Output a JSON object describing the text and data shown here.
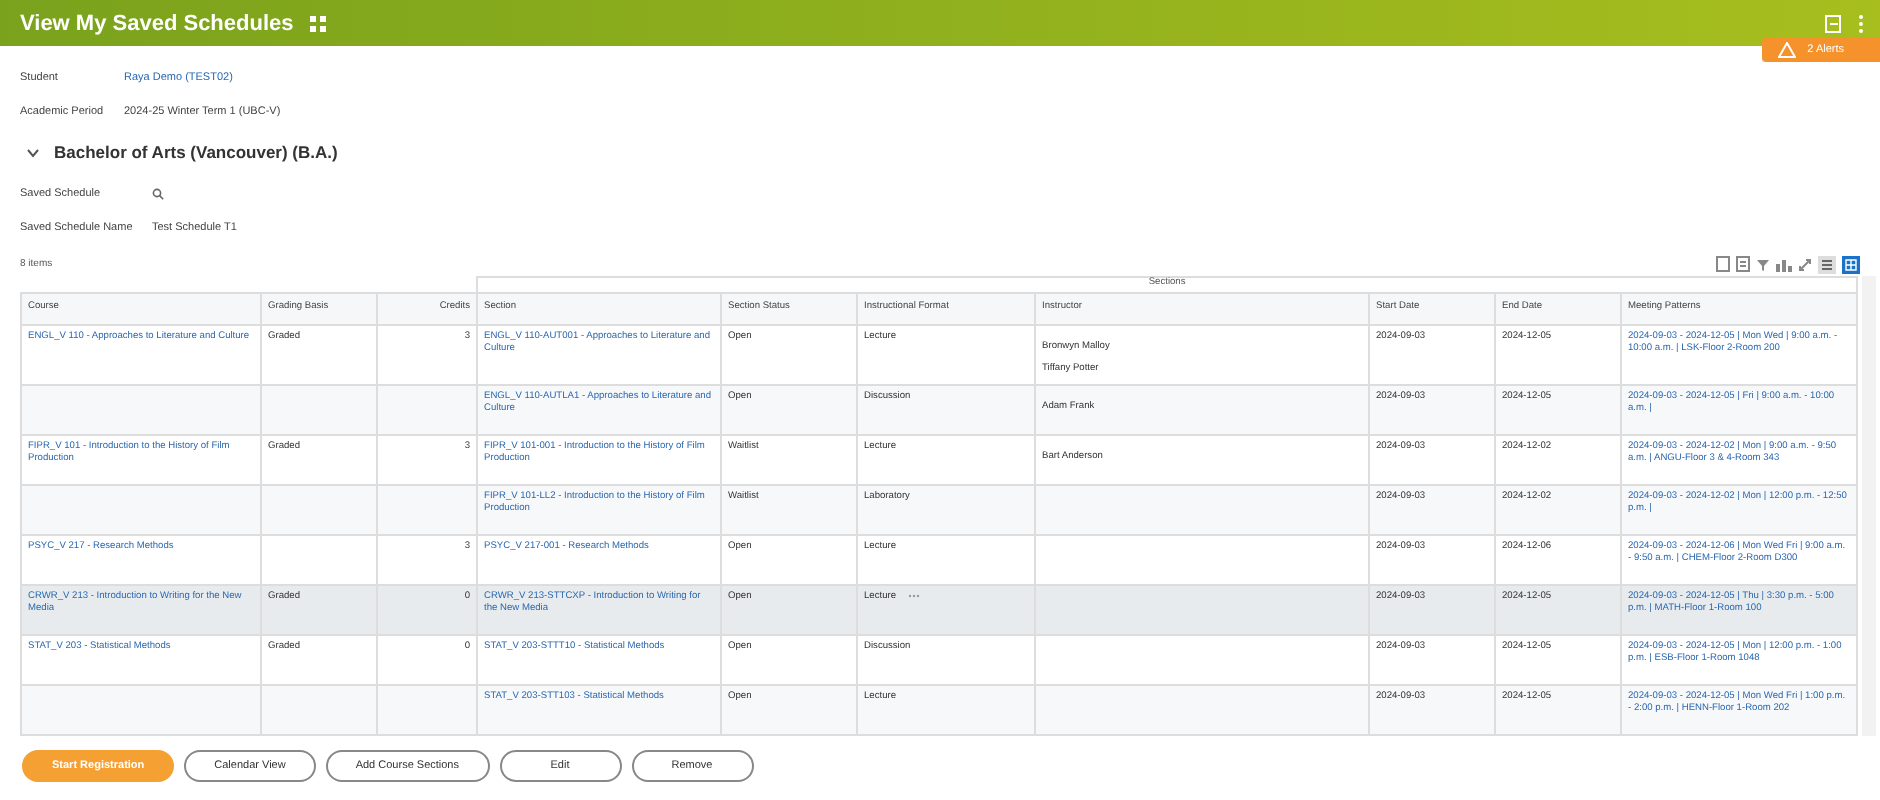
{
  "header": {
    "title": "View My Saved Schedules",
    "alert": "2 Alerts"
  },
  "student": {
    "label": "Student",
    "value": "Raya Demo (TEST02)"
  },
  "academic_period": {
    "label": "Academic Period",
    "value": "2024-25 Winter Term 1 (UBC-V)"
  },
  "program": {
    "title": "Bachelor of Arts (Vancouver) (B.A.)",
    "expanded": true
  },
  "schedule_fields": [
    {
      "label": "Saved Schedule",
      "kind": "search"
    },
    {
      "label": "Saved Schedule Name",
      "value": "Test Schedule T1",
      "kind": "text"
    }
  ],
  "table": {
    "count": "8 items",
    "group_header": "Sections",
    "columns": [
      "Course",
      "Grading Basis",
      "Credits",
      "Section",
      "Section Status",
      "Instructional Format",
      "Instructor",
      "Start Date",
      "End Date",
      "Meeting Patterns"
    ],
    "rows": [
      {
        "course": "ENGL_V 110 - Approaches to Literature and Culture",
        "grading": "Graded",
        "credits": "3",
        "section": "ENGL_V 110-AUT001 - Approaches to Literature and Culture",
        "status": "Open",
        "format": "Lecture",
        "instructors": [
          "Bronwyn Malloy",
          "Tiffany Potter"
        ],
        "start": "2024-09-03",
        "end": "2024-12-05",
        "meeting": "2024-09-03 - 2024-12-05 | Mon Wed | 9:00 a.m. - 10:00 a.m. | LSK-Floor 2-Room 200",
        "selected": false
      },
      {
        "section": "ENGL_V 110-AUTLA1 - Approaches to Literature and Culture",
        "status": "Open",
        "format": "Discussion",
        "instructors": [
          "Adam Frank"
        ],
        "start": "2024-09-03",
        "end": "2024-12-05",
        "meeting": "2024-09-03 - 2024-12-05 | Fri | 9:00 a.m. - 10:00 a.m. |",
        "selected": false
      },
      {
        "course": "FIPR_V 101 - Introduction to the History of Film Production",
        "grading": "Graded",
        "credits": "3",
        "section": "FIPR_V 101-001 - Introduction to the History of Film Production",
        "status": "Waitlist",
        "format": "Lecture",
        "instructors": [
          "Bart Anderson"
        ],
        "start": "2024-09-03",
        "end": "2024-12-02",
        "meeting": "2024-09-03 - 2024-12-02 | Mon | 9:00 a.m. - 9:50 a.m. | ANGU-Floor 3 & 4-Room 343",
        "selected": false
      },
      {
        "section": "FIPR_V 101-LL2 - Introduction to the History of Film Production",
        "status": "Waitlist",
        "format": "Laboratory",
        "instructors": [],
        "start": "2024-09-03",
        "end": "2024-12-02",
        "meeting": "2024-09-03 - 2024-12-02 | Mon | 12:00 p.m. - 12:50 p.m. |",
        "selected": false
      },
      {
        "course": "PSYC_V 217 - Research Methods",
        "credits": "3",
        "section": "PSYC_V 217-001 - Research Methods",
        "status": "Open",
        "format": "Lecture",
        "instructors": [],
        "start": "2024-09-03",
        "end": "2024-12-06",
        "meeting": "2024-09-03 - 2024-12-06 | Mon Wed Fri | 9:00 a.m. - 9:50 a.m. | CHEM-Floor 2-Room D300",
        "selected": false
      },
      {
        "course": "CRWR_V 213 - Introduction to Writing for the New Media",
        "grading": "Graded",
        "credits": "0",
        "section": "CRWR_V 213-STTCXP - Introduction to Writing for the New Media",
        "status": "Open",
        "format": "Lecture",
        "instructors": [],
        "start": "2024-09-03",
        "end": "2024-12-05",
        "meeting": "2024-09-03 - 2024-12-05 | Thu | 3:30 p.m. - 5:00 p.m. | MATH-Floor 1-Room 100",
        "selected": true
      },
      {
        "course": "STAT_V 203 - Statistical Methods",
        "grading": "Graded",
        "credits": "0",
        "section": "STAT_V 203-STTT10 - Statistical Methods",
        "status": "Open",
        "format": "Discussion",
        "instructors": [],
        "start": "2024-09-03",
        "end": "2024-12-05",
        "meeting": "2024-09-03 - 2024-12-05 | Mon | 12:00 p.m. - 1:00 p.m. | ESB-Floor 1-Room 1048",
        "selected": false
      },
      {
        "section": "STAT_V 203-STT103 - Statistical Methods",
        "status": "Open",
        "format": "Lecture",
        "instructors": [],
        "start": "2024-09-03",
        "end": "2024-12-05",
        "meeting": "2024-09-03 - 2024-12-05 | Mon Wed Fri | 1:00 p.m. - 2:00 p.m. | HENN-Floor 1-Room 202",
        "selected": false
      }
    ]
  },
  "buttons": [
    {
      "label": "Start Registration",
      "kind": "primary"
    },
    {
      "label": "Calendar View",
      "kind": "secondary"
    },
    {
      "label": "Add Course Sections",
      "kind": "secondary"
    },
    {
      "label": "Edit",
      "kind": "secondary"
    },
    {
      "label": "Remove",
      "kind": "secondary"
    }
  ]
}
